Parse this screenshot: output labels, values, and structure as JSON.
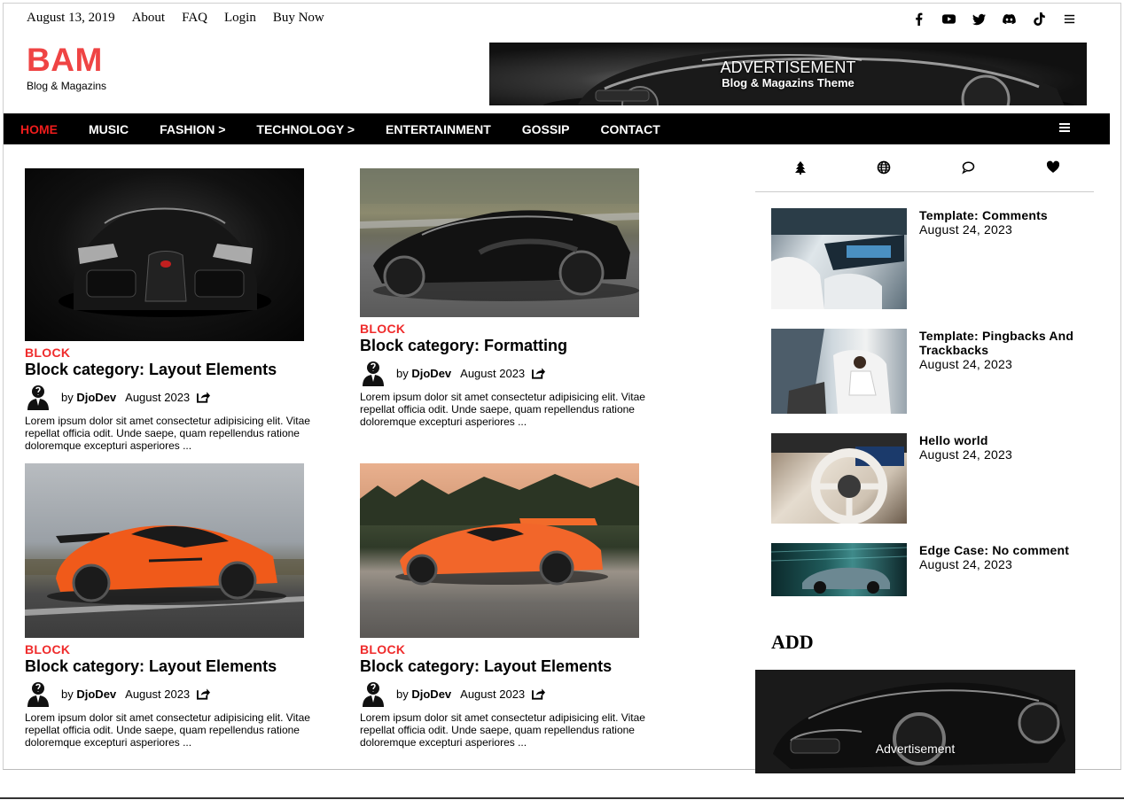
{
  "topbar": {
    "date": "August 13, 2019",
    "links": [
      "About",
      "FAQ",
      "Login",
      "Buy Now"
    ]
  },
  "social_icons": [
    "facebook-icon",
    "youtube-icon",
    "twitter-icon",
    "discord-icon",
    "tiktok-icon",
    "menu-icon"
  ],
  "brand": {
    "name": "BAM",
    "tagline": "Blog & Magazins",
    "color": "#ef4444"
  },
  "header_ad": {
    "title": "ADVERTISEMENT",
    "subtitle": "Blog & Magazins Theme"
  },
  "nav": {
    "items": [
      "HOME",
      "MUSIC",
      "FASHION >",
      "TECHNOLOGY >",
      "ENTERTAINMENT",
      "GOSSIP",
      "CONTACT"
    ],
    "active": "HOME",
    "active_color": "#ef1c1c"
  },
  "posts": [
    {
      "category": "BLOCK",
      "title": "Block category: Layout Elements",
      "by": "by",
      "author": "DjoDev",
      "date": "August 2023",
      "excerpt": "Lorem ipsum dolor sit amet consectetur adipisicing elit. Vitae repellat officia odit. Unde saepe, quam repellendus ratione doloremque excepturi asperiores ...",
      "image": "black-hypercar-front"
    },
    {
      "category": "BLOCK",
      "title": "Block category: Formatting",
      "by": "by",
      "author": "DjoDev",
      "date": "August 2023",
      "excerpt": "Lorem ipsum dolor sit amet consectetur adipisicing elit. Vitae repellat officia odit. Unde saepe, quam repellendus ratione doloremque excepturi asperiores ...",
      "image": "black-hypercar-road"
    },
    {
      "category": "BLOCK",
      "title": "Block category: Layout Elements",
      "by": "by",
      "author": "DjoDev",
      "date": "August 2023",
      "excerpt": "Lorem ipsum dolor sit amet consectetur adipisicing elit. Vitae repellat officia odit. Unde saepe, quam repellendus ratione doloremque excepturi asperiores ...",
      "image": "orange-supercar-runway"
    },
    {
      "category": "BLOCK",
      "title": "Block category: Layout Elements",
      "by": "by",
      "author": "DjoDev",
      "date": "August 2023",
      "excerpt": "Lorem ipsum dolor sit amet consectetur adipisicing elit. Vitae repellat officia odit. Unde saepe, quam repellendus ratione doloremque excepturi asperiores ...",
      "image": "orange-supercar-sunset"
    }
  ],
  "sidebar": {
    "tabs": [
      "tree-icon",
      "globe-icon",
      "comment-icon",
      "heart-icon"
    ],
    "recent": [
      {
        "title": "Template: Comments",
        "date": "August 24, 2023",
        "image": "car-interior-front"
      },
      {
        "title": "Template: Pingbacks And Trackbacks",
        "date": "August 24, 2023",
        "image": "car-interior-rear"
      },
      {
        "title": "Hello world",
        "date": "August 24, 2023",
        "image": "steering-wheel"
      },
      {
        "title": "Edge Case: No comment",
        "date": "August 24, 2023",
        "image": "teal-sedan"
      }
    ],
    "add_heading": "ADD",
    "ad_label": "Advertisement"
  }
}
